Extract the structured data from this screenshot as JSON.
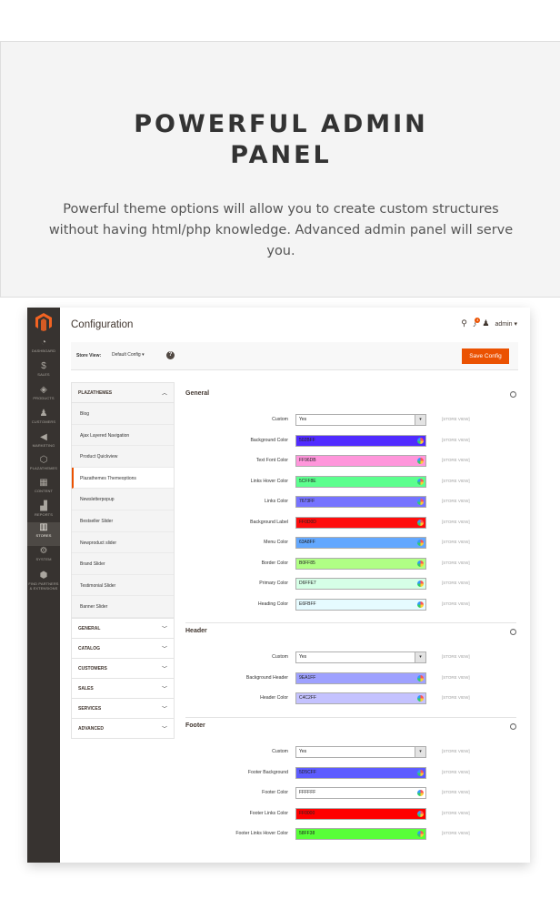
{
  "promo": {
    "title_line1": "POWERFUL ADMIN",
    "title_line2": "PANEL",
    "description": "Powerful theme options will allow you to create custom structures without having html/php knowledge. Advanced admin panel will serve you."
  },
  "sidebar": {
    "items": [
      {
        "label": "DASHBOARD",
        "icon": "dashboard-icon",
        "glyph": "◔"
      },
      {
        "label": "SALES",
        "icon": "dollar-icon",
        "glyph": "$"
      },
      {
        "label": "PRODUCTS",
        "icon": "box-icon",
        "glyph": "◈"
      },
      {
        "label": "CUSTOMERS",
        "icon": "person-icon",
        "glyph": "♟"
      },
      {
        "label": "MARKETING",
        "icon": "megaphone-icon",
        "glyph": "◀"
      },
      {
        "label": "PLAZATHEMES",
        "icon": "hexagon-icon",
        "glyph": "⬡"
      },
      {
        "label": "CONTENT",
        "icon": "layout-icon",
        "glyph": "▦"
      },
      {
        "label": "REPORTS",
        "icon": "bar-chart-icon",
        "glyph": "▟"
      },
      {
        "label": "STORES",
        "icon": "store-icon",
        "glyph": "▥"
      },
      {
        "label": "SYSTEM",
        "icon": "gear-icon",
        "glyph": "⚙"
      },
      {
        "label": "FIND PARTNERS & EXTENSIONS",
        "icon": "cube-icon",
        "glyph": "⬢"
      }
    ]
  },
  "header": {
    "title": "Configuration",
    "notifications_count": "4",
    "user": "admin"
  },
  "storebar": {
    "label": "Store View:",
    "value": "Default Config",
    "help": "?",
    "save": "Save Config"
  },
  "menu": {
    "head": "PLAZATHEMES",
    "subitems": [
      "Blog",
      "Ajax Layered Navigation",
      "Product Quickview",
      "Plazathemes Themeoptions",
      "Newsletterpopup",
      "Bestseller Slider",
      "Newproduct slider",
      "Brand Slider",
      "Testimonial Slider",
      "Banner Slider"
    ],
    "sections": [
      "GENERAL",
      "CATALOG",
      "CUSTOMERS",
      "SALES",
      "SERVICES",
      "ADVANCED"
    ]
  },
  "scope_label": "[STORE VIEW]",
  "groups": {
    "general": {
      "title": "General",
      "rows": [
        {
          "label": "Custom",
          "value": "Yes"
        },
        {
          "label": "Background Color",
          "value": "502BFF",
          "color": "#502BFF"
        },
        {
          "label": "Text Font Color",
          "value": "FF96DB",
          "color": "#FF96DB"
        },
        {
          "label": "Links Hover Color",
          "value": "5CFF8E",
          "color": "#5CFF8E"
        },
        {
          "label": "Links Color",
          "value": "7673FF",
          "color": "#7673FF"
        },
        {
          "label": "Background Label",
          "value": "FF0D0D",
          "color": "#FF0D0D"
        },
        {
          "label": "Menu Color",
          "value": "63A8FF",
          "color": "#63A8FF"
        },
        {
          "label": "Border Color",
          "value": "B0FF85",
          "color": "#B0FF85"
        },
        {
          "label": "Primary Color",
          "value": "D6FFE7",
          "color": "#D6FFE7"
        },
        {
          "label": "Heading Color",
          "value": "E6FBFF",
          "color": "#E6FBFF"
        }
      ]
    },
    "header": {
      "title": "Header",
      "rows": [
        {
          "label": "Custom",
          "value": "Yes"
        },
        {
          "label": "Background Header",
          "value": "9EA1FF",
          "color": "#9EA1FF"
        },
        {
          "label": "Header Color",
          "value": "C4C2FF",
          "color": "#C4C2FF"
        }
      ]
    },
    "footer": {
      "title": "Footer",
      "rows": [
        {
          "label": "Custom",
          "value": "Yes"
        },
        {
          "label": "Footer Background",
          "value": "5D5CFF",
          "color": "#5D5CFF"
        },
        {
          "label": "Footer Color",
          "value": "FFFFFF",
          "color": "#FFFFFF"
        },
        {
          "label": "Footer Links Color",
          "value": "FF0000",
          "color": "#FF0000"
        },
        {
          "label": "Footer Links Hover Color",
          "value": "58FF38",
          "color": "#58FF38"
        }
      ]
    }
  }
}
